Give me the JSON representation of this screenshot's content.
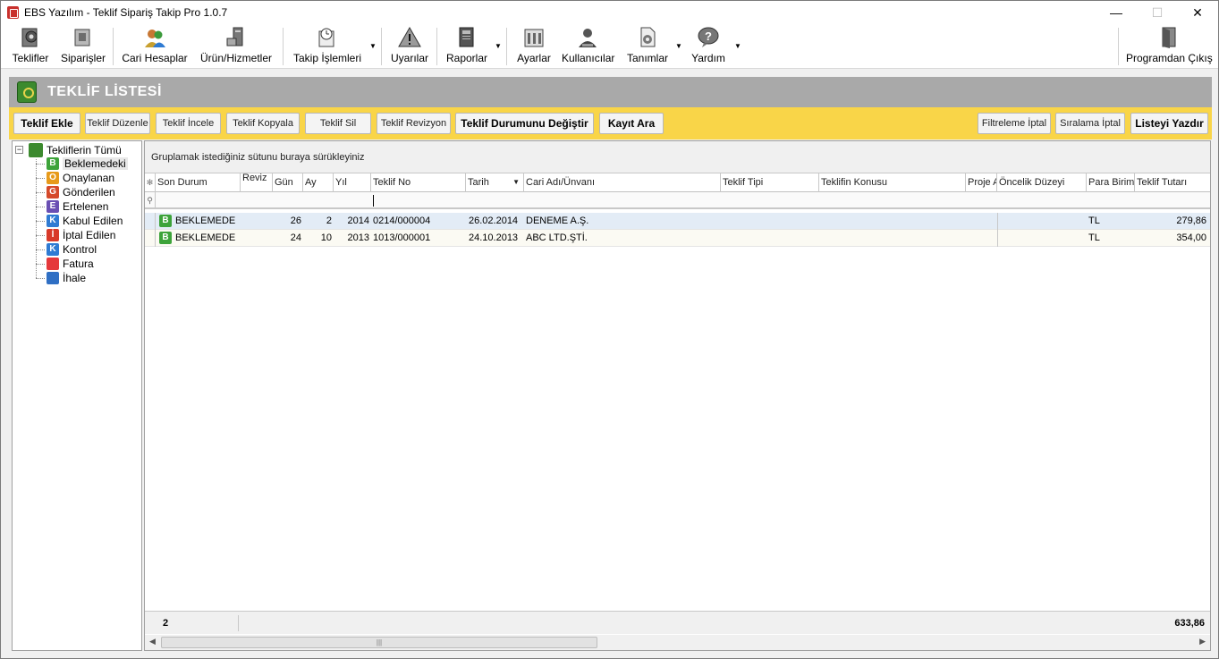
{
  "window": {
    "title": "EBS Yazılım - Teklif Sipariş Takip Pro 1.0.7",
    "min_glyph": "—",
    "max_glyph": "☐",
    "close_glyph": "✕"
  },
  "toolbar": {
    "items": [
      {
        "label": "Teklifler",
        "icon": "quotes-icon"
      },
      {
        "label": "Siparişler",
        "icon": "orders-icon"
      },
      {
        "label": "Cari Hesaplar",
        "icon": "accounts-icon"
      },
      {
        "label": "Ürün/Hizmetler",
        "icon": "products-icon"
      },
      {
        "label": "Takip İşlemleri",
        "icon": "tracking-icon"
      },
      {
        "label": "Uyarılar",
        "icon": "warning-icon"
      },
      {
        "label": "Raporlar",
        "icon": "reports-icon"
      },
      {
        "label": "Ayarlar",
        "icon": "settings-icon"
      },
      {
        "label": "Kullanıcılar",
        "icon": "users-icon"
      },
      {
        "label": "Tanımlar",
        "icon": "definitions-icon"
      },
      {
        "label": "Yardım",
        "icon": "help-icon"
      },
      {
        "label": "Programdan Çıkış",
        "icon": "exit-icon"
      }
    ]
  },
  "header": {
    "title": "TEKLİF LİSTESİ"
  },
  "actions": {
    "add": "Teklif Ekle",
    "edit": "Teklif Düzenle",
    "inspect": "Teklif İncele",
    "copy": "Teklif Kopyala",
    "delete": "Teklif Sil",
    "revision": "Teklif Revizyon",
    "change_status": "Teklif Durumunu Değiştir",
    "search": "Kayıt Ara",
    "cancel_filter": "Filtreleme İptal",
    "cancel_sort": "Sıralama İptal",
    "print": "Listeyi Yazdır"
  },
  "tree": {
    "root": "Tekliflerin Tümü",
    "items": [
      {
        "label": "Beklemedeki",
        "badge": "B",
        "color": "#3da33a"
      },
      {
        "label": "Onaylanan",
        "badge": "O",
        "color": "#e79a1a"
      },
      {
        "label": "Gönderilen",
        "badge": "G",
        "color": "#d5492a"
      },
      {
        "label": "Ertelenen",
        "badge": "E",
        "color": "#6a4fb3"
      },
      {
        "label": "Kabul Edilen",
        "badge": "K",
        "color": "#2f7bd3"
      },
      {
        "label": "İptal Edilen",
        "badge": "İ",
        "color": "#d83a2a"
      },
      {
        "label": "Kontrol",
        "badge": "K",
        "color": "#2f7bd3"
      },
      {
        "label": "Fatura",
        "badge": "",
        "color": "#e5383b"
      },
      {
        "label": "İhale",
        "badge": "",
        "color": "#2f6fc4"
      }
    ]
  },
  "grid": {
    "group_hint": "Gruplamak istediğiniz sütunu buraya sürükleyiniz",
    "columns": {
      "status": "Son Durum",
      "revision": "Reviz",
      "day": "Gün",
      "month": "Ay",
      "year": "Yıl",
      "quote_no": "Teklif No",
      "date": "Tarih",
      "account": "Cari Adı/Ünvanı",
      "type": "Teklif Tipi",
      "subject": "Teklifin Konusu",
      "project": "Proje Adı",
      "priority": "Öncelik Düzeyi",
      "currency": "Para Birimi",
      "amount": "Teklif Tutarı"
    },
    "rows": [
      {
        "badge": "B",
        "status": "BEKLEMEDE",
        "day": "26",
        "month": "2",
        "year": "2014",
        "quote_no": "0214/000004",
        "date": "26.02.2014",
        "account": "DENEME A.Ş.",
        "currency": "TL",
        "amount": "279,86"
      },
      {
        "badge": "B",
        "status": "BEKLEMEDE",
        "day": "24",
        "month": "10",
        "year": "2013",
        "quote_no": "1013/000001",
        "date": "24.10.2013",
        "account": "ABC LTD.ŞTİ.",
        "currency": "TL",
        "amount": "354,00"
      }
    ],
    "footer": {
      "count": "2",
      "total": "633,86"
    }
  }
}
